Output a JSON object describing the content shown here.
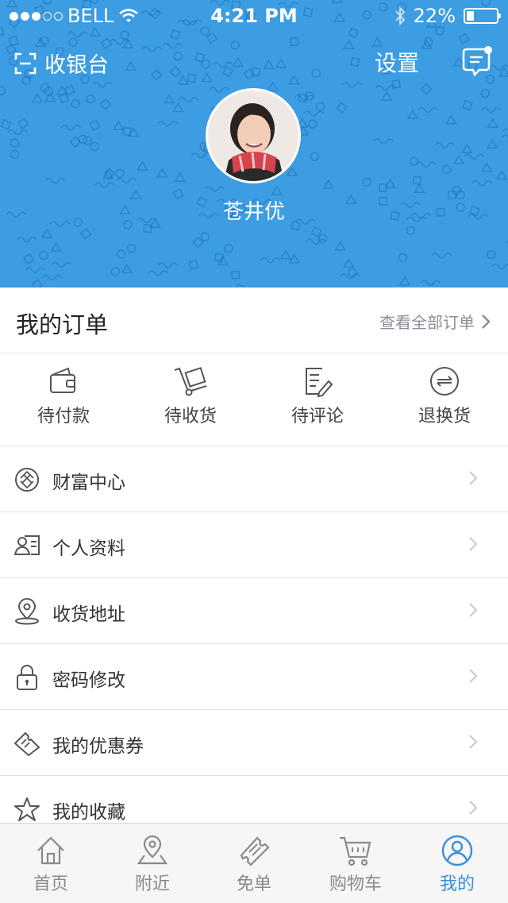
{
  "status_bar": {
    "carrier": "BELL",
    "time": "4:21 PM",
    "battery": "22%"
  },
  "header": {
    "cashier_label": "收银台",
    "settings_label": "设置",
    "username": "苍井优"
  },
  "orders": {
    "title": "我的订单",
    "view_all": "查看全部订单",
    "items": [
      {
        "label": "待付款",
        "icon": "wallet-icon"
      },
      {
        "label": "待收货",
        "icon": "delivery-cart-icon"
      },
      {
        "label": "待评论",
        "icon": "review-edit-icon"
      },
      {
        "label": "退换货",
        "icon": "exchange-icon"
      }
    ]
  },
  "menu": [
    {
      "label": "财富中心",
      "icon": "wealth-icon"
    },
    {
      "label": "个人资料",
      "icon": "profile-card-icon"
    },
    {
      "label": "收货地址",
      "icon": "location-pin-icon"
    },
    {
      "label": "密码修改",
      "icon": "lock-icon"
    },
    {
      "label": "我的优惠券",
      "icon": "coupon-icon"
    },
    {
      "label": "我的收藏",
      "icon": "star-icon"
    }
  ],
  "tabbar": [
    {
      "label": "首页",
      "icon": "home-icon"
    },
    {
      "label": "附近",
      "icon": "nearby-map-icon"
    },
    {
      "label": "免单",
      "icon": "ticket-icon"
    },
    {
      "label": "购物车",
      "icon": "cart-icon"
    },
    {
      "label": "我的",
      "icon": "user-icon",
      "active": true
    }
  ],
  "colors": {
    "header_bg": "#3c9de2",
    "active_tab": "#3b8fd8",
    "notification_dot": "#ffffff"
  }
}
